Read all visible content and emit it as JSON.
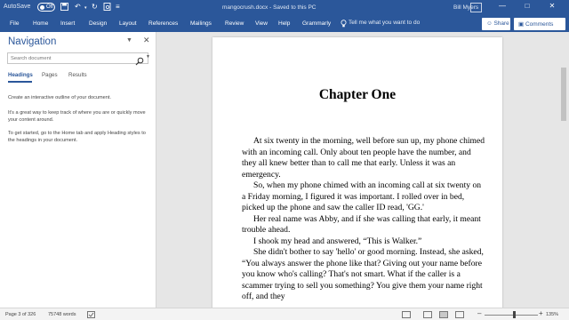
{
  "titlebar": {
    "autosave_label": "AutoSave",
    "autosave_state": "Off",
    "doc_title": "mangocrush.docx  -  Saved to this PC",
    "user": "Bill Myers"
  },
  "ribbon": {
    "tabs": [
      "File",
      "Home",
      "Insert",
      "Design",
      "Layout",
      "References",
      "Mailings",
      "Review",
      "View",
      "Help",
      "Grammarly"
    ],
    "tell_me": "Tell me what you want to do",
    "share": "Share",
    "comments": "Comments"
  },
  "navigation": {
    "title": "Navigation",
    "search_placeholder": "Search document",
    "tabs": [
      "Headings",
      "Pages",
      "Results"
    ],
    "active_tab": "Headings",
    "text1": "Create an interactive outline of your document.",
    "text2": "It's a great way to keep track of where you are or quickly move your content around.",
    "text3": "To get started, go to the Home tab and apply Heading styles to the headings in your document."
  },
  "document": {
    "heading": "Chapter One",
    "paragraphs": [
      "At six twenty in the morning, well before sun up, my phone chimed with an incoming call. Only about ten people have the number, and they all knew better than to call me that early. Unless it was an emergency.",
      "So, when my phone chimed with an incoming call at six twenty on a Friday morning, I figured it was important. I rolled over in bed, picked up the phone and saw the caller ID read, 'GG.'",
      "Her real name was Abby, and if she was calling that early, it meant trouble ahead.",
      "I shook my head and answered, “This is Walker.”",
      "She didn't bother to say 'hello' or good morning. Instead, she asked, “You always answer the phone like that? Giving out your name before you know who's calling? That's not smart. What if the caller is a scammer trying to sell you something? You give them your name right off, and they"
    ]
  },
  "statusbar": {
    "page": "Page 3 of 326",
    "words": "75748 words",
    "zoom": "135%"
  },
  "colors": {
    "accent": "#2b579a"
  }
}
